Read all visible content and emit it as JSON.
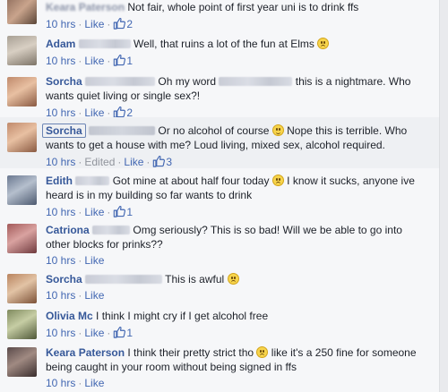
{
  "like_label": "Like",
  "edited_label": "Edited",
  "comments": [
    {
      "author": "Keara Paterson",
      "parts": [
        "Not fair, whole point of first year uni is to drink ffs"
      ],
      "time": "10 hrs",
      "likes": "2"
    },
    {
      "author": "Adam",
      "parts": [
        "Well, that ruins a lot of the fun at Elms"
      ],
      "time": "10 hrs",
      "likes": "1"
    },
    {
      "author": "Sorcha",
      "parts": [
        "Oh my word",
        "this is a nightmare. Who wants quiet living or single sex?!"
      ],
      "time": "10 hrs",
      "likes": "2"
    },
    {
      "author": "Sorcha",
      "parts": [
        "Or no alcohol of course",
        "Nope this is terrible. Who wants to get a house with me? Loud living, mixed sex, alcohol required."
      ],
      "time": "10 hrs",
      "likes": "3"
    },
    {
      "author": "Edith",
      "parts": [
        "Got mine at about half four today",
        "I know it sucks, anyone ive heard is in my building so far wants to drink"
      ],
      "time": "10 hrs",
      "likes": "1"
    },
    {
      "author": "Catriona",
      "parts": [
        "Omg seriously? This is so bad! Will we be able to go into other blocks for prinks??"
      ],
      "time": "10 hrs"
    },
    {
      "author": "Sorcha",
      "parts": [
        "This is awful"
      ],
      "time": "10 hrs"
    },
    {
      "author": "Olivia Mc",
      "parts": [
        "I think I might cry if I get alcohol free"
      ],
      "time": "10 hrs",
      "likes": "1"
    },
    {
      "author": "Keara Paterson",
      "parts": [
        "I think their pretty strict tho",
        "like it's a 250 fine for someone being caught in your room without being signed in ffs"
      ],
      "time": "10 hrs"
    }
  ]
}
